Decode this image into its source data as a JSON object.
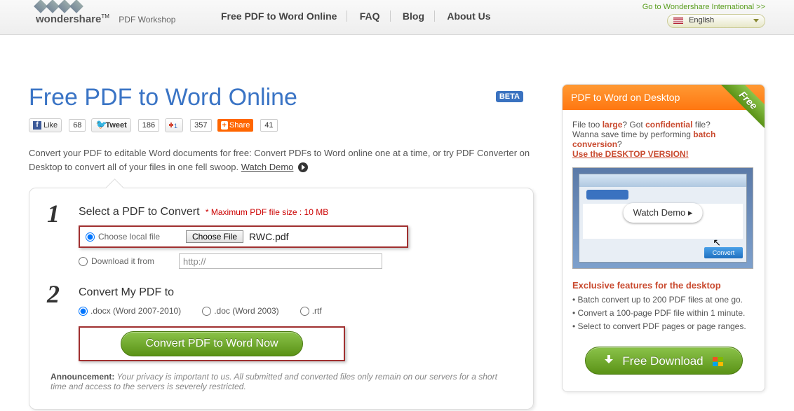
{
  "header": {
    "brand": "wondershare",
    "tm": "TM",
    "workshop": "PDF Workshop",
    "nav": [
      "Free PDF to Word Online",
      "FAQ",
      "Blog",
      "About Us"
    ],
    "intl_link": "Go to Wondershare International >>",
    "language": "English"
  },
  "main": {
    "title": "Free PDF to Word Online",
    "beta": "BETA",
    "social": {
      "like": "Like",
      "like_count": "68",
      "tweet": "Tweet",
      "tweet_count": "186",
      "plus1": "+1",
      "plus1_count": "357",
      "share": "Share",
      "share_count": "41"
    },
    "intro": "Convert your PDF to editable Word documents for free: Convert PDFs to Word online one at a time, or try PDF Converter on Desktop to convert all of your files in one fell swoop. ",
    "watch_demo": "Watch Demo",
    "step1": {
      "num": "1",
      "title": "Select a PDF to Convert",
      "maxsize": "* Maximum PDF file size : 10 MB",
      "choose_local": "Choose local file",
      "choose_btn": "Choose File",
      "filename": "RWC.pdf",
      "download_from": "Download it from",
      "url_value": "http://"
    },
    "step2": {
      "num": "2",
      "title": "Convert My PDF to",
      "opts": [
        ".docx (Word 2007-2010)",
        ".doc (Word 2003)",
        ".rtf"
      ],
      "convert_btn": "Convert PDF to Word Now"
    },
    "announce_label": "Announcement:",
    "announce": " Your privacy is important to us. All submitted and converted files only remain on our servers for a short time and access to the servers is severely restricted."
  },
  "side": {
    "header": "PDF to Word on Desktop",
    "free": "Free",
    "line1a": "File too ",
    "line1b": "large",
    "line1c": "? Got ",
    "line1d": "confidential",
    "line1e": " file?",
    "line2a": "Wanna save time by performing ",
    "line2b": "batch conversion",
    "line2c": "?",
    "desktop_link": "Use the DESKTOP VERSION!",
    "demo_btn": "Watch Demo  ▸",
    "convert_label": "Convert",
    "excl_title": "Exclusive features for the desktop",
    "feat": [
      "• Batch convert up to 200 PDF files at one go.",
      "• Convert a 100-page PDF file within 1 minute.",
      "• Select to convert PDF pages or page ranges."
    ],
    "download": "Free Download"
  }
}
